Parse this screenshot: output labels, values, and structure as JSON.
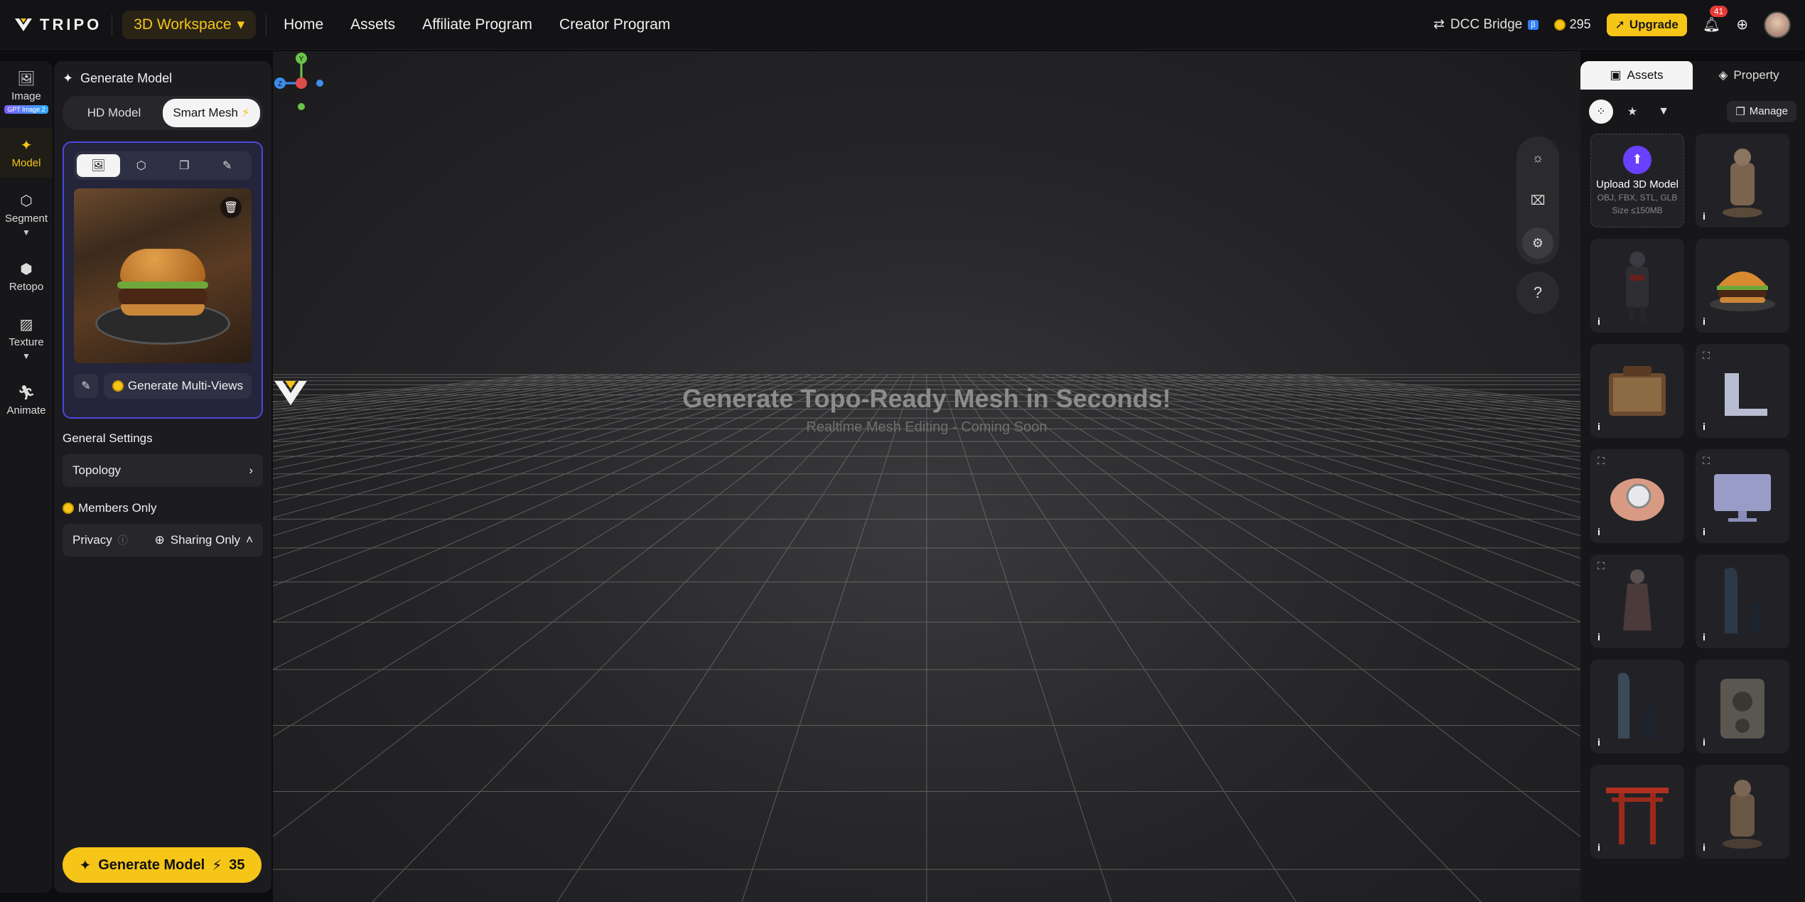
{
  "header": {
    "logo_text": "TRIPO",
    "workspace_label": "3D Workspace",
    "nav": [
      "Home",
      "Assets",
      "Affiliate Program",
      "Creator Program"
    ],
    "dcc_label": "DCC Bridge",
    "dcc_badge": "β",
    "credits": "295",
    "upgrade_label": "Upgrade",
    "notifications": "41"
  },
  "rail": {
    "image_label": "Image",
    "image_badge": "GPT Image 2",
    "model_label": "Model",
    "segment_label": "Segment",
    "retopo_label": "Retopo",
    "texture_label": "Texture",
    "animate_label": "Animate"
  },
  "panel": {
    "title": "Generate Model",
    "mode_hd": "HD Model",
    "mode_smart": "Smart Mesh",
    "multi_views_label": "Generate Multi-Views",
    "general_settings": "General Settings",
    "topology_label": "Topology",
    "members_only": "Members Only",
    "privacy_label": "Privacy",
    "privacy_value": "Sharing Only",
    "generate_label": "Generate Model",
    "generate_cost": "35"
  },
  "viewport": {
    "headline": "Generate Topo-Ready Mesh in Seconds!",
    "subline": "Realtime Mesh Editing - Coming Soon",
    "axis_y": "Y",
    "axis_z": "Z"
  },
  "rpanel": {
    "tab_assets": "Assets",
    "tab_property": "Property",
    "manage_label": "Manage",
    "upload_title": "Upload 3D Model",
    "upload_formats": "OBJ, FBX, STL, GLB",
    "upload_size": "Size ≤150MB"
  },
  "colors": {
    "accent": "#f5c518",
    "card_border": "#4a4ae0",
    "upload": "#6a40ff"
  }
}
